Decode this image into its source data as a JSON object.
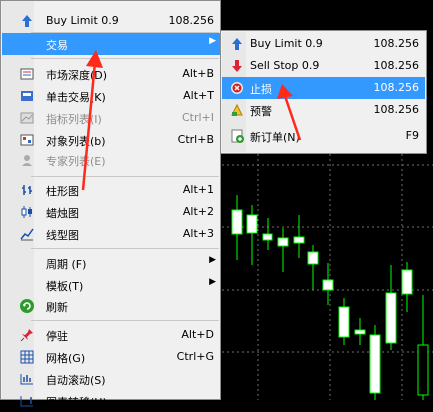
{
  "menu": {
    "items": [
      {
        "label": "Buy Limit 0.9",
        "shortcut": "108.256",
        "icon": "buy-limit-icon"
      },
      {
        "label": "交易",
        "shortcut": "",
        "icon": "",
        "submenu": true,
        "selected": true
      },
      {
        "label": "市场深度(D)",
        "shortcut": "Alt+B",
        "icon": "market-depth-icon"
      },
      {
        "label": "单击交易(K)",
        "shortcut": "Alt+T",
        "icon": "one-click-trade-icon"
      },
      {
        "label": "指标列表(I)",
        "shortcut": "Ctrl+I",
        "icon": "indicator-list-icon",
        "disabled": true
      },
      {
        "label": "对象列表(b)",
        "shortcut": "Ctrl+B",
        "icon": "object-list-icon"
      },
      {
        "label": "专家列表(E)",
        "shortcut": "",
        "icon": "expert-list-icon",
        "disabled": true
      },
      {
        "label": "柱形图",
        "shortcut": "Alt+1",
        "icon": "bar-chart-icon"
      },
      {
        "label": "蜡烛图",
        "shortcut": "Alt+2",
        "icon": "candlestick-icon"
      },
      {
        "label": "线型图",
        "shortcut": "Alt+3",
        "icon": "line-chart-icon"
      },
      {
        "label": "周期 (F)",
        "shortcut": "",
        "icon": "",
        "submenu": true
      },
      {
        "label": "模板(T)",
        "shortcut": "",
        "icon": "",
        "submenu": true
      },
      {
        "label": "刷新",
        "shortcut": "",
        "icon": "refresh-icon"
      },
      {
        "label": "停驻",
        "shortcut": "Alt+D",
        "icon": "pin-icon"
      },
      {
        "label": "网格(G)",
        "shortcut": "Ctrl+G",
        "icon": "grid-icon"
      },
      {
        "label": "自动滚动(S)",
        "shortcut": "",
        "icon": "auto-scroll-icon"
      },
      {
        "label": "图表转移(H)",
        "shortcut": "",
        "icon": "chart-shift-icon"
      }
    ]
  },
  "submenu": {
    "items": [
      {
        "label": "Buy Limit 0.9",
        "shortcut": "108.256",
        "icon": "buy-limit-icon"
      },
      {
        "label": "Sell Stop 0.9",
        "shortcut": "108.256",
        "icon": "sell-stop-icon"
      },
      {
        "label": "止损",
        "shortcut": "108.256",
        "icon": "stop-loss-icon",
        "selected": true
      },
      {
        "label": "预警",
        "shortcut": "108.256",
        "icon": "alert-icon"
      },
      {
        "label": "新订单(N)",
        "shortcut": "F9",
        "icon": "new-order-icon"
      }
    ]
  },
  "colors": {
    "highlight": "#3399ff",
    "candle_up": "#00ff00",
    "candle_body": "#ffffff",
    "annotation": "#ff2a1a"
  }
}
